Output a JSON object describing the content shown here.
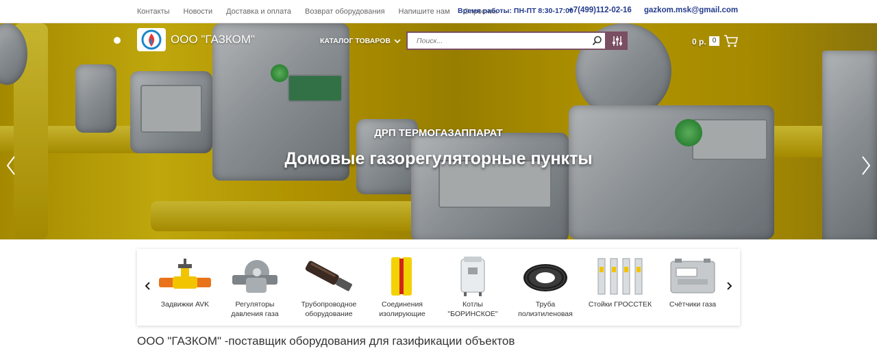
{
  "topnav": {
    "links": [
      "Контакты",
      "Новости",
      "Доставка и оплата",
      "Возврат оборудования",
      "Напишите нам",
      "Опросник"
    ],
    "worktime": "Время работы: ПН-ПТ 8:30-17:00",
    "phone": "+7(499)112-02-16",
    "email": "gazkom.msk@gmail.com"
  },
  "header": {
    "brand": "ООО \"ГАЗКОМ\"",
    "catalog_label": "КАТАЛОГ ТОВАРОВ",
    "search_placeholder": "Поиск...",
    "cart_price": "0 р.",
    "cart_count": "0"
  },
  "hero": {
    "subtitle": "ДРП ТЕРМОГАЗАППАРАТ",
    "title": "Домовые газорегуляторные пункты"
  },
  "categories": [
    {
      "label": "Задвижки AVK",
      "icon": "gate-valve-icon"
    },
    {
      "label": "Регуляторы давления газа",
      "icon": "pressure-regulator-icon"
    },
    {
      "label": "Трубопроводное оборудование",
      "icon": "pipe-fitting-icon"
    },
    {
      "label": "Соединения изолирующие",
      "icon": "insulating-joint-icon"
    },
    {
      "label": "Котлы \"БОРИНСКОЕ\"",
      "icon": "boiler-icon"
    },
    {
      "label": "Труба полиэтиленовая",
      "icon": "pipe-coil-icon"
    },
    {
      "label": "Стойки ГРОССТЕК",
      "icon": "rack-icon"
    },
    {
      "label": "Счётчики газа",
      "icon": "gas-meter-icon"
    }
  ],
  "headline": "ООО \"ГАЗКОМ\" -поставщик оборудования для газификации объектов",
  "colors": {
    "accent": "#7a4e63",
    "link": "#223a8c",
    "hero_yellow": "#e2c200"
  }
}
